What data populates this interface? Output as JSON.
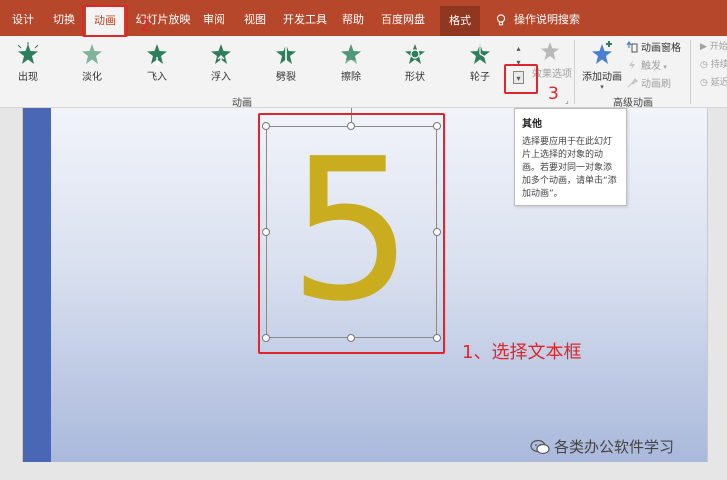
{
  "tabs": [
    {
      "label": "设计"
    },
    {
      "label": "切换"
    },
    {
      "label": "动画"
    },
    {
      "label": "幻灯片放映"
    },
    {
      "label": "审阅"
    },
    {
      "label": "视图"
    },
    {
      "label": "开发工具"
    },
    {
      "label": "帮助"
    },
    {
      "label": "百度网盘"
    },
    {
      "label": "格式"
    }
  ],
  "tell_me": "操作说明搜索",
  "animations": [
    {
      "label": "出现"
    },
    {
      "label": "淡化"
    },
    {
      "label": "飞入"
    },
    {
      "label": "浮入"
    },
    {
      "label": "劈裂"
    },
    {
      "label": "擦除"
    },
    {
      "label": "形状"
    },
    {
      "label": "轮子"
    }
  ],
  "effect_options": "效果选项",
  "group_animation": "动画",
  "group_advanced": "高级动画",
  "add_animation": "添加动画",
  "advanced": [
    {
      "label": "动画窗格"
    },
    {
      "label": "触发"
    },
    {
      "label": "动画刷"
    }
  ],
  "right_cmds": [
    {
      "label": "开始"
    },
    {
      "label": "持续"
    },
    {
      "label": "延迟"
    }
  ],
  "tooltip": {
    "title": "其他",
    "body": "选择要应用于在此幻灯片上选择的对象的动画。若要对同一对象添加多个动画，请单击“添加动画”。"
  },
  "slide_text": "5",
  "annotations": {
    "step1": "1、选择文本框",
    "step2": "2",
    "step3": "3"
  },
  "watermark": "各类办公软件学习",
  "colors": {
    "ribbon_red": "#b7472a",
    "annotation_red": "#e0252b",
    "digit_gold": "#c9ad1f",
    "star_green": "#2e7d5c",
    "slide_bar": "#4a67b5"
  }
}
